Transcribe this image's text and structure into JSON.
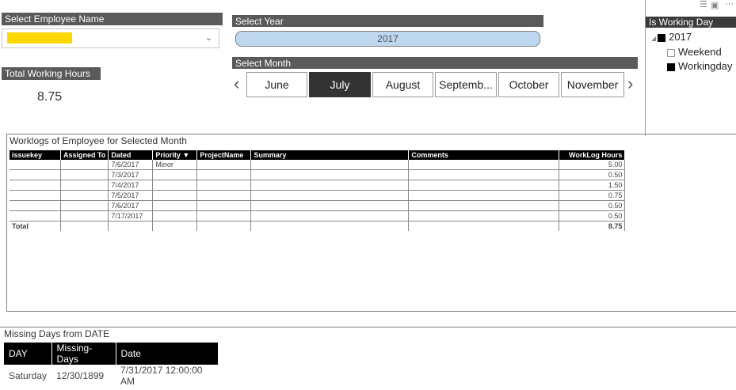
{
  "employee": {
    "header": "Select Employee Name",
    "selected_value": ""
  },
  "total_hours": {
    "header": "Total Working Hours",
    "value": "8.75"
  },
  "year": {
    "header": "Select Year",
    "selected": "2017"
  },
  "month": {
    "header": "Select Month",
    "options": [
      "June",
      "July",
      "August",
      "Septemb...",
      "October",
      "November"
    ],
    "selected": "July"
  },
  "working_day": {
    "header": "Is Working Day",
    "year": "2017",
    "items": [
      {
        "label": "Weekend",
        "checked": false
      },
      {
        "label": "Workingday",
        "checked": true
      }
    ]
  },
  "worklogs": {
    "title": "Worklogs of Employee for Selected Month",
    "columns": [
      "issuekey",
      "Assigned To",
      "Dated",
      "Priority",
      "ProjectName",
      "Summary",
      "Comments",
      "WorkLog Hours"
    ],
    "rows": [
      {
        "issuekey": "",
        "assigned": "",
        "dated": "7/6/2017",
        "priority": "Minor",
        "project": "",
        "summary": "",
        "comments": "",
        "hours": "5.00"
      },
      {
        "issuekey": "",
        "assigned": "",
        "dated": "7/3/2017",
        "priority": "",
        "project": "",
        "summary": "",
        "comments": "",
        "hours": "0.50"
      },
      {
        "issuekey": "",
        "assigned": "",
        "dated": "7/4/2017",
        "priority": "",
        "project": "",
        "summary": "",
        "comments": "",
        "hours": "1.50"
      },
      {
        "issuekey": "",
        "assigned": "",
        "dated": "7/5/2017",
        "priority": "",
        "project": "",
        "summary": "",
        "comments": "",
        "hours": "0.75"
      },
      {
        "issuekey": "",
        "assigned": "",
        "dated": "7/6/2017",
        "priority": "",
        "project": "",
        "summary": "",
        "comments": "",
        "hours": "0.50"
      },
      {
        "issuekey": "",
        "assigned": "",
        "dated": "7/17/2017",
        "priority": "",
        "project": "",
        "summary": "",
        "comments": "",
        "hours": "0.50"
      }
    ],
    "total_label": "Total",
    "total_hours": "8.75"
  },
  "missing_days": {
    "title": "Missing Days from DATE",
    "columns": [
      "DAY",
      "Missing-Days",
      "Date"
    ],
    "rows": [
      {
        "day": "Saturday",
        "missing": "12/30/1899",
        "date": "7/31/2017 12:00:00 AM"
      }
    ]
  }
}
